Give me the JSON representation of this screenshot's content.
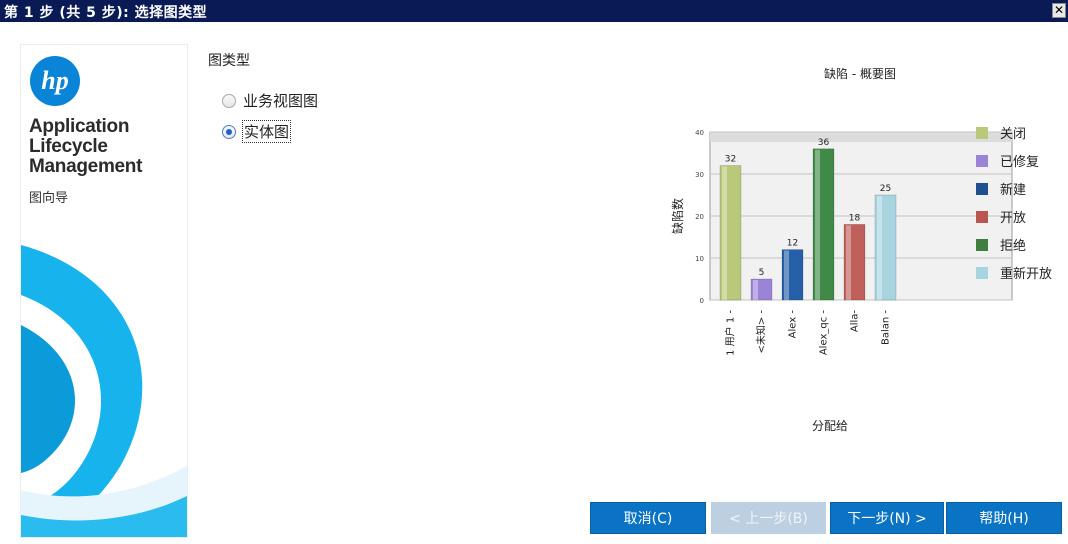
{
  "window": {
    "title": "第 1 步 (共 5 步): 选择图类型",
    "close_glyph": "✕"
  },
  "brand": {
    "logo_text": "hp",
    "lines": [
      "Application",
      "Lifecycle",
      "Management"
    ],
    "subtitle": "图向导"
  },
  "chart_type": {
    "label": "图类型",
    "options": [
      {
        "label": "业务视图图",
        "selected": false
      },
      {
        "label": "实体图",
        "selected": true
      }
    ]
  },
  "colors": {
    "titlebar": "#0a1a54",
    "button": "#0a73c4",
    "button_disabled": "#bcd0e2"
  },
  "chart_data": {
    "type": "bar",
    "title": "缺陷 - 概要图",
    "xlabel": "分配给",
    "ylabel": "缺陷数",
    "ylim": [
      0,
      40
    ],
    "yticks": [
      0,
      10,
      20,
      30,
      40
    ],
    "grid": true,
    "legend_position": "right",
    "categories": [
      "1 用户 1 -",
      "<未知> -",
      "Alex -",
      "Alex_qc -",
      "Alla-",
      "Balan -"
    ],
    "values": [
      32,
      5,
      12,
      36,
      18,
      25
    ],
    "bar_colors": [
      "#b8c97a",
      "#9b84d6",
      "#2660a8",
      "#3f8a47",
      "#c0605a",
      "#a8d4e0"
    ],
    "legend": [
      {
        "name": "关闭",
        "color": "#b8c97a"
      },
      {
        "name": "已修复",
        "color": "#9b84d6"
      },
      {
        "name": "新建",
        "color": "#1f4e91"
      },
      {
        "name": "开放",
        "color": "#b8564f"
      },
      {
        "name": "拒绝",
        "color": "#3f7e3f"
      },
      {
        "name": "重新开放",
        "color": "#a8d4e0"
      }
    ]
  },
  "buttons": {
    "cancel": "取消(C)",
    "back": "< 上一步(B)",
    "next": "下一步(N) >",
    "help": "帮助(H)"
  }
}
